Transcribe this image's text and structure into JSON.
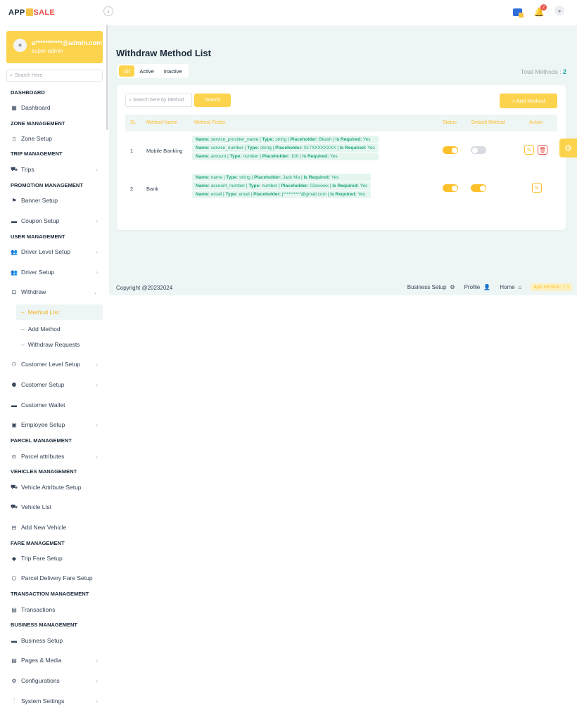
{
  "brand": {
    "app": "APP",
    "sale": "SALE"
  },
  "profile": {
    "email": "a***********@admin.com",
    "role": "super-admin"
  },
  "sidebar_search": {
    "placeholder": "Search Here"
  },
  "nav": {
    "dashboard_heading": "DASHBOARD",
    "dashboard": "Dashboard",
    "zone_heading": "ZONE MANAGEMENT",
    "zone_setup": "Zone Setup",
    "trip_heading": "TRIP MANAGEMENT",
    "trips": "Trips",
    "promotion_heading": "PROMOTION MANAGEMENT",
    "banner_setup": "Banner Setup",
    "coupon_setup": "Coupon Setup",
    "user_heading": "USER MANAGEMENT",
    "driver_level_setup": "Driver Level Setup",
    "driver_setup": "Driver Setup",
    "withdraw": "Withdraw",
    "method_list": "Method List",
    "add_method": "Add Method",
    "withdraw_requests": "Withdraw Requests",
    "customer_level_setup": "Customer Level Setup",
    "customer_setup": "Customer Setup",
    "customer_wallet": "Customer Wallet",
    "employee_setup": "Employee Setup",
    "parcel_heading": "PARCEL MANAGEMENT",
    "parcel_attributes": "Parcel attributes",
    "vehicles_heading": "VEHICLES MANAGEMENT",
    "vehicle_attribute_setup": "Vehicle Attribute Setup",
    "vehicle_list": "Vehicle List",
    "add_new_vehicle": "Add New Vehicle",
    "fare_heading": "FARE MANAGEMENT",
    "trip_fare_setup": "Trip Fare Setup",
    "parcel_delivery_fare_setup": "Parcel Delivery Fare Setup",
    "transaction_heading": "TRANSACTION MANAGEMENT",
    "transactions": "Transactions",
    "business_heading": "BUSINESS MANAGEMENT",
    "business_setup": "Business Setup",
    "pages_media": "Pages & Media",
    "configurations": "Configurations",
    "system_settings": "System Settings"
  },
  "topbar": {
    "notification_count": "2"
  },
  "page": {
    "title": "Withdraw Method List",
    "tabs": {
      "all": "All",
      "active": "Active",
      "inactive": "Inactive"
    },
    "total_label": "Total Methods :",
    "total_value": "2",
    "search_placeholder": "Search here by Method",
    "search_button": "Search",
    "add_button": "+ Add Method"
  },
  "table": {
    "headers": {
      "sl": "SL",
      "method_name": "Method Name",
      "method_fields": "Method Fields",
      "status": "Status",
      "default_method": "Default Method",
      "action": "Action"
    },
    "rows": [
      {
        "sl": "1",
        "name": "Mobile Banking",
        "status": true,
        "default": false,
        "fields": [
          {
            "name": "service_provider_name",
            "type": "string",
            "placeholder": "Bkash",
            "required": "Yes"
          },
          {
            "name": "service_number",
            "type": "string",
            "placeholder": "017XXXXXXXX",
            "required": "Yes"
          },
          {
            "name": "amount",
            "type": "number",
            "placeholder": "100",
            "required": "Yes"
          }
        ]
      },
      {
        "sl": "2",
        "name": "Bank",
        "status": true,
        "default": true,
        "fields": [
          {
            "name": "name",
            "type": "string",
            "placeholder": "Jack Ma",
            "required": "Yes"
          },
          {
            "name": "account_number",
            "type": "number",
            "placeholder": "02xxxxxx",
            "required": "Yes"
          },
          {
            "name": "email",
            "type": "email",
            "placeholder": "j**********@gmail.com",
            "required": "Yes"
          }
        ]
      }
    ],
    "field_labels": {
      "name": "Name:",
      "type": "Type:",
      "placeholder": "Placeholder:",
      "required": "Is Required:"
    }
  },
  "footer": {
    "copyright": "Copyright @20232024",
    "business_setup": "Business Setup",
    "profile": "Profile",
    "home": "Home",
    "version": "App version: 1.1"
  },
  "colors": {
    "accent": "#fcd34d",
    "teal": "#14a39a",
    "danger": "#e8534b",
    "bg": "#eef6f5"
  }
}
